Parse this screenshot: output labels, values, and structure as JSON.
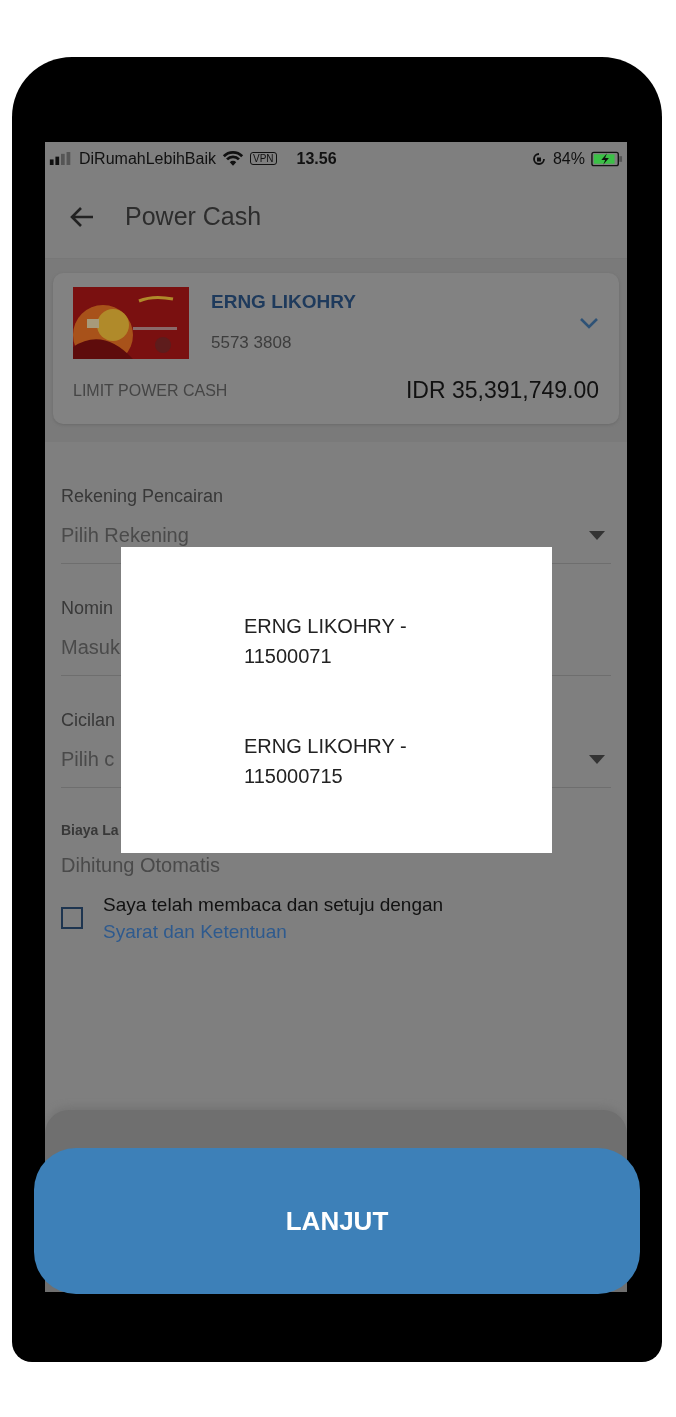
{
  "status_bar": {
    "carrier": "DiRumahLebihBaik",
    "vpn": "VPN",
    "time": "13.56",
    "battery": "84%"
  },
  "header": {
    "title": "Power Cash"
  },
  "card": {
    "holder": "ERNG LIKOHRY",
    "number": "5573 3808",
    "limit_label": "LIMIT POWER CASH",
    "limit": "IDR 35,391,749.00"
  },
  "fields": [
    {
      "kind": "dropdown",
      "label": "Rekening Pencairan",
      "placeholder": "Pilih Rekening"
    },
    {
      "kind": "input",
      "label": "Nomin",
      "placeholder": "Masuk"
    },
    {
      "kind": "dropdown",
      "label": "Cicilan",
      "placeholder": "Pilih c"
    },
    {
      "kind": "static",
      "label": "Biaya La",
      "value": "Dihitung Otomatis"
    }
  ],
  "agreement": {
    "checked": false,
    "text": "Saya telah membaca dan setuju dengan",
    "link": "Syarat dan Ketentuan"
  },
  "dialog": {
    "options": [
      {
        "label": "ERNG LIKOHRY - 11500071"
      },
      {
        "label": "ERNG LIKOHRY - 115000715"
      }
    ]
  },
  "button": {
    "label": "LANJUT"
  }
}
